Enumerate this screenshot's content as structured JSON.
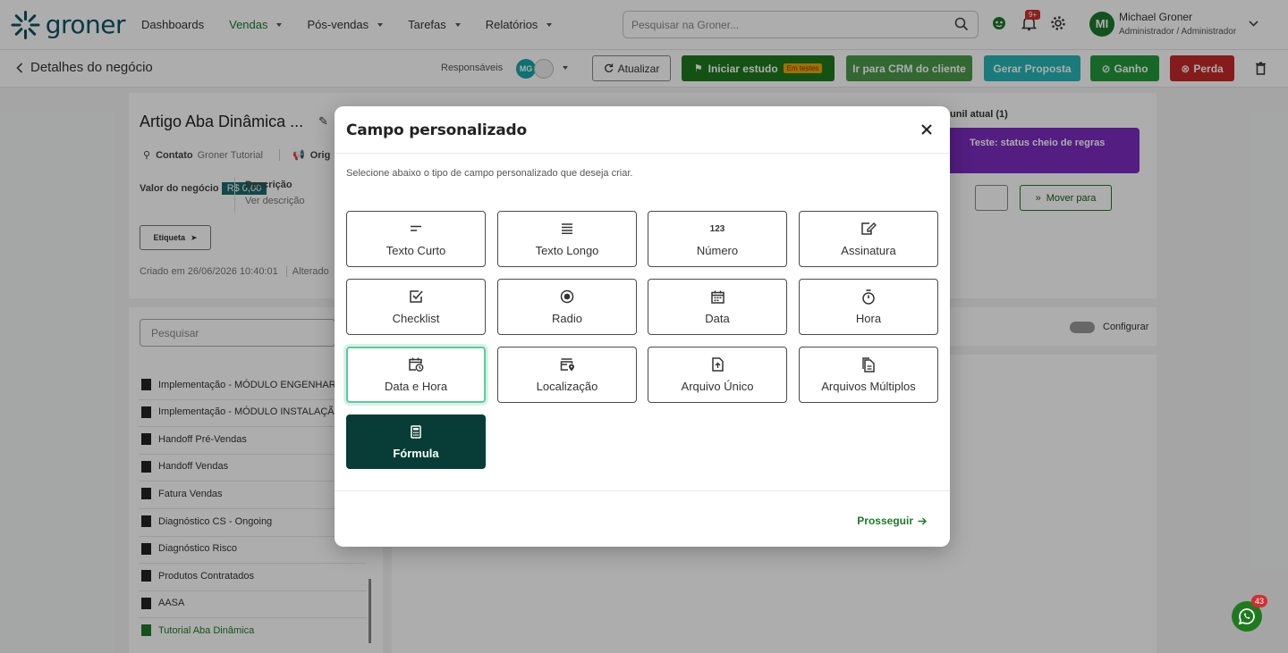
{
  "brand": {
    "name": "groner"
  },
  "nav": {
    "items": [
      {
        "label": "Dashboards",
        "dropdown": false,
        "active": false
      },
      {
        "label": "Vendas",
        "dropdown": true,
        "active": true
      },
      {
        "label": "Pós-vendas",
        "dropdown": true,
        "active": false
      },
      {
        "label": "Tarefas",
        "dropdown": true,
        "active": false
      },
      {
        "label": "Relatórios",
        "dropdown": true,
        "active": false
      }
    ],
    "search_placeholder": "Pesquisar na Groner...",
    "notifications_badge": "9+"
  },
  "user": {
    "initials": "MI",
    "name": "Michael Groner",
    "role": "Administrador / Administrador"
  },
  "subheader": {
    "back_label": "Detalhes do negócio",
    "responsaveis_label": "Responsáveis",
    "responsavel_initials": "MG",
    "buttons": {
      "atualizar": "Atualizar",
      "iniciar_estudo": "Iniciar estudo",
      "em_testes": "Em testes",
      "crm": "Ir para CRM do cliente",
      "proposta": "Gerar Proposta",
      "ganho": "Ganho",
      "perda": "Perda"
    }
  },
  "deal": {
    "title": "Artigo Aba Dinâmica ...",
    "contato_label": "Contato",
    "contato_value": "Groner Tutorial",
    "origem_label": "Orig",
    "valor_label": "Valor do negócio",
    "valor_value": "R$ 0,00",
    "descricao_label": "Descrição",
    "descricao_value": "Ver descrição",
    "etiqueta_label": "Etiqueta",
    "criado": "Criado em 26/06/2026 10:40:01",
    "alterado": "Alterado",
    "funil_label": "unil atual (1)",
    "status_text": "Teste: status cheio de regras",
    "mover_label": "Mover para",
    "configurar_label": "Configurar"
  },
  "sidebar_list": {
    "search_placeholder": "Pesquisar",
    "items": [
      "Implementação - MÓDULO ENGENHAR",
      "Implementação - MÓDULO INSTALAÇÃ",
      "Handoff Pré-Vendas",
      "Handoff Vendas",
      "Fatura Vendas",
      "Diagnóstico CS - Ongoing",
      "Diagnóstico Risco",
      "Produtos Contratados",
      "AASA",
      "Tutorial Aba Dinâmica"
    ],
    "active_index": 9
  },
  "modal": {
    "title": "Campo personalizado",
    "description": "Selecione abaixo o tipo de campo personalizado que deseja criar.",
    "options": [
      {
        "label": "Texto Curto",
        "icon": "short-text-icon"
      },
      {
        "label": "Texto Longo",
        "icon": "long-text-icon"
      },
      {
        "label": "Número",
        "icon": "number-icon"
      },
      {
        "label": "Assinatura",
        "icon": "signature-icon"
      },
      {
        "label": "Checklist",
        "icon": "checklist-icon"
      },
      {
        "label": "Radio",
        "icon": "radio-icon"
      },
      {
        "label": "Data",
        "icon": "calendar-icon"
      },
      {
        "label": "Hora",
        "icon": "stopwatch-icon"
      },
      {
        "label": "Data e Hora",
        "icon": "calendar-clock-icon",
        "selected": true
      },
      {
        "label": "Localização",
        "icon": "location-icon"
      },
      {
        "label": "Arquivo Único",
        "icon": "file-upload-icon"
      },
      {
        "label": "Arquivos Múltiplos",
        "icon": "files-icon"
      },
      {
        "label": "Fórmula",
        "icon": "calculator-icon",
        "highlighted": true
      }
    ],
    "number_icon_text": "123",
    "next_label": "Prosseguir"
  },
  "whatsapp": {
    "badge": "43"
  },
  "colors": {
    "brand": "#0b5563",
    "green": "#1d7a2a",
    "dark_green": "#073d36",
    "teal": "#15a7a7",
    "red": "#c62828",
    "purple": "#7b2cbf",
    "selected_border": "#5ccaa0"
  }
}
